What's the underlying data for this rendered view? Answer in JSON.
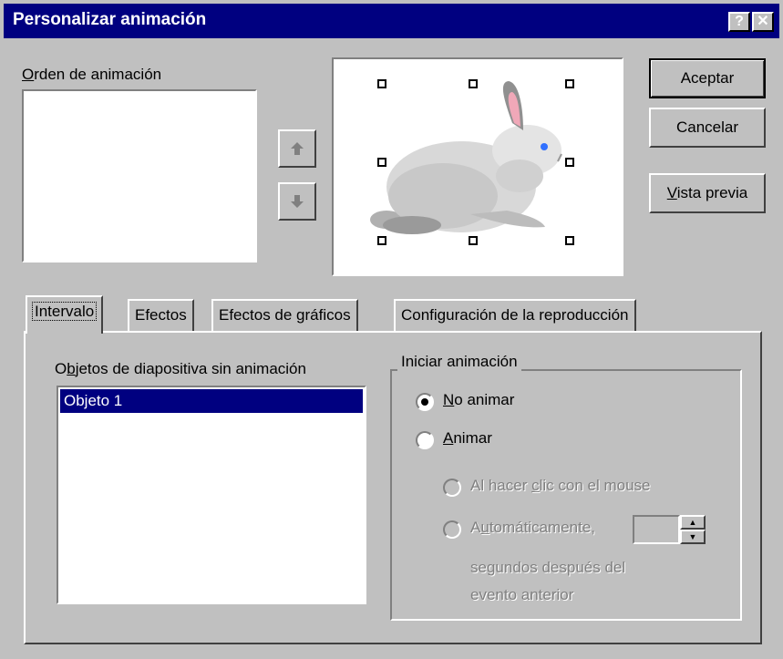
{
  "dialog": {
    "title": "Personalizar animación",
    "help_label": "?",
    "close_label": "✕"
  },
  "order_section": {
    "label_first": "O",
    "label_rest": "rden de animación",
    "items": [],
    "move_up_icon": "arrow-up-icon",
    "move_down_icon": "arrow-down-icon"
  },
  "preview": {
    "image": "rabbit-clipart"
  },
  "buttons": {
    "accept": "Aceptar",
    "cancel": "Cancelar",
    "preview_first": "V",
    "preview_rest": "ista previa"
  },
  "tabs": [
    {
      "label": "Intervalo",
      "active": true
    },
    {
      "label": "Efectos",
      "active": false
    },
    {
      "label": "Efectos de gráficos",
      "active": false
    },
    {
      "label": "Configuración de la reproducción",
      "active": false
    }
  ],
  "intervalo": {
    "objects_label_a": "O",
    "objects_label_u": "b",
    "objects_label_rest": "jetos de diapositiva sin animación",
    "objects": [
      "Objeto 1"
    ],
    "selected_object": "Objeto 1",
    "start_group_label": "Iniciar animación",
    "no_animate_u": "N",
    "no_animate_rest": "o animar",
    "animate_u": "A",
    "animate_rest": "nimar",
    "on_click_a": "Al hacer ",
    "on_click_u": "c",
    "on_click_rest": "lic con el mouse",
    "auto_a": "A",
    "auto_u": "u",
    "auto_rest": "tomáticamente,",
    "seconds_value": "",
    "seconds_line1": "segundos después del",
    "seconds_line2": "evento anterior",
    "selected_option": "No animar"
  },
  "colors": {
    "titlebar": "#000080",
    "face": "#c0c0c0",
    "selection": "#000080"
  }
}
